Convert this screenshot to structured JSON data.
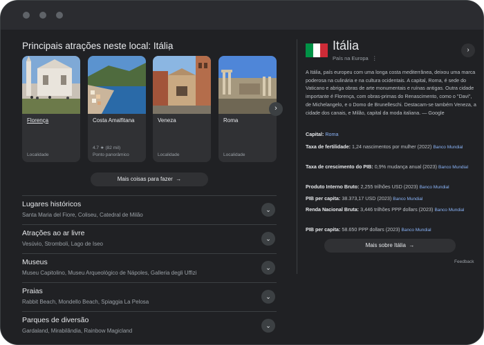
{
  "window": {
    "controls": [
      "close",
      "minimize",
      "maximize"
    ]
  },
  "attractions": {
    "title": "Principais atrações neste local: Itália",
    "menu_icon": "more-vert-icon",
    "cards": [
      {
        "name": "Florença",
        "rating": "",
        "type": "Localidade",
        "name_underlined": true
      },
      {
        "name": "Costa Amalfitana",
        "rating": "4.7 ★ (82 mil)",
        "type": "Ponto panorâmico",
        "name_underlined": false
      },
      {
        "name": "Veneza",
        "rating": "",
        "type": "Localidade",
        "name_underlined": false
      },
      {
        "name": "Roma",
        "rating": "",
        "type": "Localidade",
        "name_underlined": false
      }
    ],
    "next_icon": "chevron-right-icon",
    "more_button": "Mais coisas para fazer"
  },
  "categories": [
    {
      "title": "Lugares históricos",
      "sub": "Santa Maria del Fiore, Coliseu, Catedral de Milão"
    },
    {
      "title": "Atrações ao ar livre",
      "sub": "Vesúvio, Stromboli, Lago de Iseo"
    },
    {
      "title": "Museus",
      "sub": "Museu Capitolino, Museu Arqueológico de Nápoles, Galleria degli Uffizi"
    },
    {
      "title": "Praias",
      "sub": "Rabbit Beach, Mondello Beach, Spiaggia La Pelosa"
    },
    {
      "title": "Parques de diversão",
      "sub": "Gardaland, Mirabilândia, Rainbow Magicland"
    }
  ],
  "knowledge_panel": {
    "title": "Itália",
    "subtitle": "País na Europa",
    "flag_colors": [
      "#009246",
      "#ffffff",
      "#ce2b37"
    ],
    "description": "A Itália, país europeu com uma longa costa mediterrânea, deixou uma marca poderosa na culinária e na cultura ocidentais. A capital, Roma, é sede do Vaticano e abriga obras de arte monumentais e ruínas antigas. Outra cidade importante é Florença, com obras-primas do Renascimento, como o \"Davi\", de Michelangelo, e o Domo de Brunelleschi. Destacam-se também Veneza, a cidade dos canais, e Milão, capital da moda italiana.",
    "description_source": "— Google",
    "facts": [
      {
        "label": "Capital:",
        "value": "Roma",
        "source": ""
      },
      {
        "label": "Taxa de fertilidade:",
        "value": "1,24 nascimentos por mulher (2022)",
        "source": "Banco Mundial"
      },
      {
        "label": "Taxa de crescimento do PIB:",
        "value": "0,9% mudança anual (2023)",
        "source": "Banco Mundial"
      },
      {
        "label": "Produto Interno Bruto:",
        "value": "2,255 trilhões USD (2023)",
        "source": "Banco Mundial"
      },
      {
        "label": "PIB per capita:",
        "value": "38.373,17 USD (2023)",
        "source": "Banco Mundial"
      },
      {
        "label": "Renda Nacional Bruta:",
        "value": "3,446 trilhões PPP dollars (2023)",
        "source": "Banco Mundial"
      },
      {
        "label": "PIB per capita:",
        "value": "58.650 PPP dollars (2023)",
        "source": "Banco Mundial"
      }
    ],
    "more_button": "Mais sobre Itália",
    "feedback": "Feedback"
  }
}
